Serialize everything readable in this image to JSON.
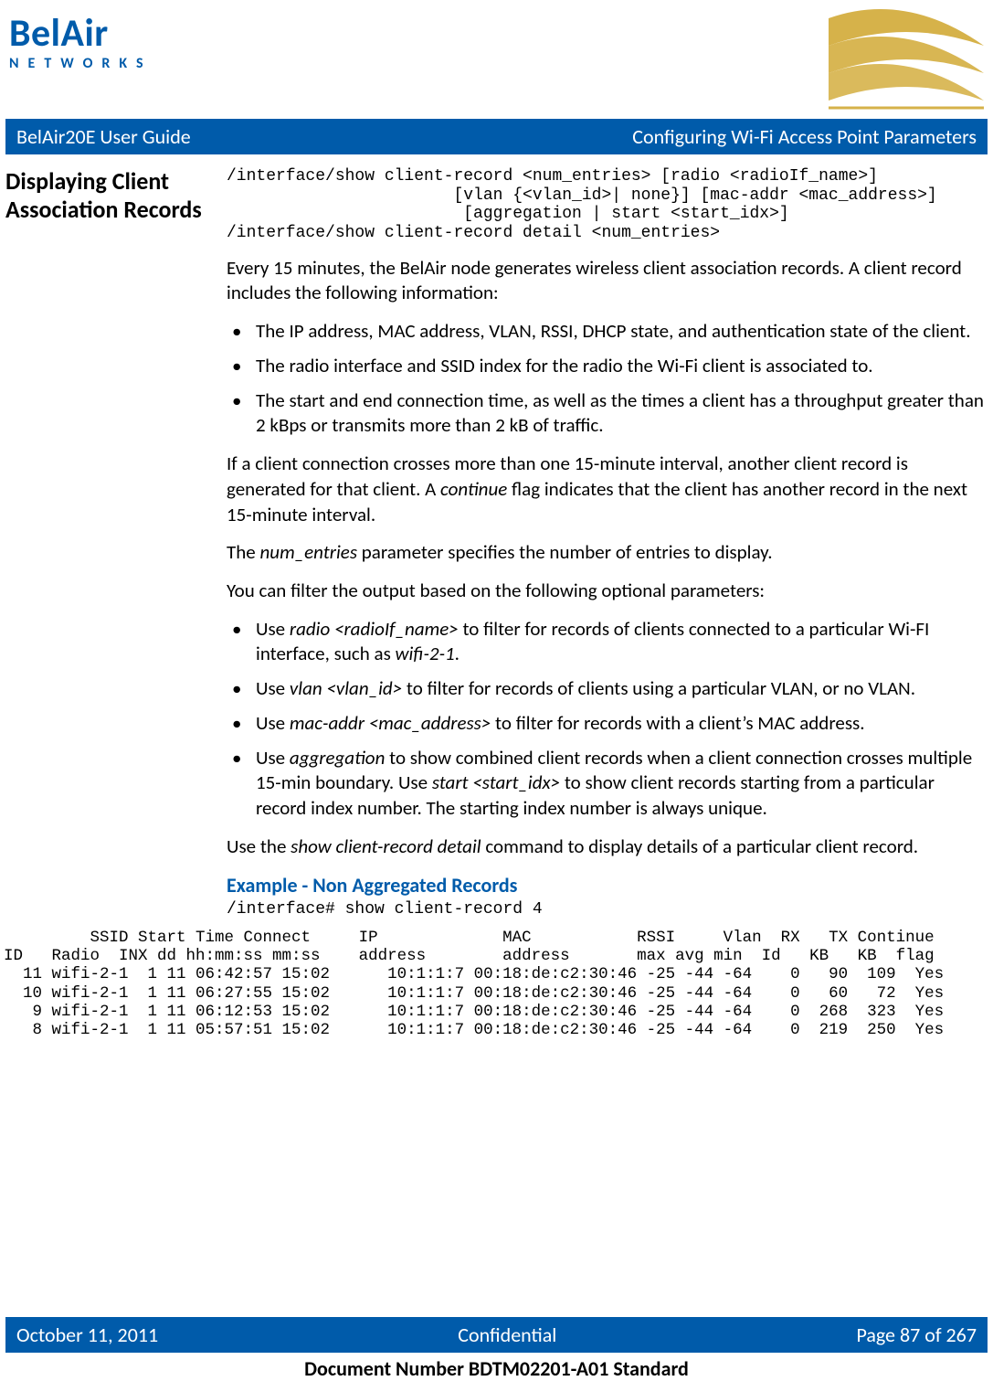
{
  "logo": {
    "top": "BelAir",
    "bottom": "NETWORKS"
  },
  "bar": {
    "left": "BelAir20E User Guide",
    "right": "Configuring Wi-Fi Access Point Parameters"
  },
  "side_heading": "Displaying Client Association Records",
  "cmd_block": "/interface/show client-record <num_entries> [radio <radioIf_name>]\n                       [vlan {<vlan_id>| none}] [mac-addr <mac_address>]\n                        [aggregation | start <start_idx>]\n/interface/show client-record detail <num_entries>",
  "intro": "Every 15 minutes, the BelAir node generates wireless client association records. A client record includes the following information:",
  "bullets1": [
    "The IP address, MAC address, VLAN, RSSI, DHCP state, and authentication state of the client.",
    "The radio interface and SSID index for the radio the Wi-Fi client is associated to.",
    "The start and end connection time, as well as the times a client has a throughput greater than 2 kBps or transmits more than 2 kB of traffic."
  ],
  "para_continue_before": "If a client connection crosses more than one 15-minute interval, another client record is generated for that client. A ",
  "para_continue_em": "continue",
  "para_continue_after": " flag indicates that the client has another record in the next 15-minute interval.",
  "para_num_before": "The ",
  "para_num_em": "num_entries",
  "para_num_after": " parameter specifies the number of entries to display.",
  "para_filter": "You can filter the output based on the following optional parameters:",
  "b2": {
    "a_pre": "Use ",
    "a_em": "radio <radioIf_name>",
    "a_mid": " to filter for records of clients connected to a particular Wi-FI interface, such as ",
    "a_em2": "wifi-2-1",
    "a_post": ".",
    "b_pre": "Use ",
    "b_em": "vlan <vlan_id>",
    "b_post": " to filter for records of clients using a particular VLAN, or no VLAN.",
    "c_pre": "Use ",
    "c_em": "mac-addr <mac_address>",
    "c_post": " to filter for records with a client’s MAC address.",
    "d_pre": "Use ",
    "d_em": "aggregation",
    "d_mid": " to show combined client records when a client connection crosses multiple 15-min boundary. Use ",
    "d_em2": "start <start_idx>",
    "d_post": " to show client records starting from a particular record index number. The starting index number is always unique."
  },
  "para_detail_before": "Use the ",
  "para_detail_em": "show client-record detail",
  "para_detail_after": " command to display details of a particular client record.",
  "example_title": "Example - Non Aggregated Records",
  "example_cmd": "/interface# show client-record 4",
  "table_text": "         SSID Start Time Connect     IP             MAC           RSSI     Vlan  RX   TX Continue\nID   Radio  INX dd hh:mm:ss mm:ss    address        address       max avg min  Id   KB   KB  flag\n  11 wifi-2-1  1 11 06:42:57 15:02      10:1:1:7 00:18:de:c2:30:46 -25 -44 -64    0   90  109  Yes\n  10 wifi-2-1  1 11 06:27:55 15:02      10:1:1:7 00:18:de:c2:30:46 -25 -44 -64    0   60   72  Yes\n   9 wifi-2-1  1 11 06:12:53 15:02      10:1:1:7 00:18:de:c2:30:46 -25 -44 -64    0  268  323  Yes\n   8 wifi-2-1  1 11 05:57:51 15:02      10:1:1:7 00:18:de:c2:30:46 -25 -44 -64    0  219  250  Yes",
  "footer": {
    "date": "October 11, 2011",
    "conf": "Confidential",
    "page": "Page 87 of 267",
    "docnum": "Document Number BDTM02201-A01 Standard"
  }
}
